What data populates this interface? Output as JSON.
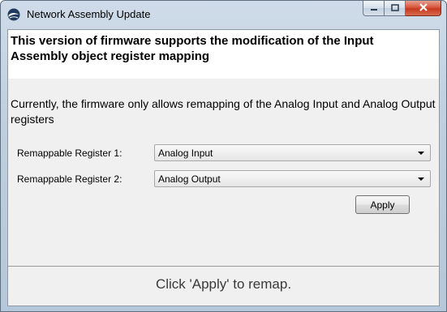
{
  "window": {
    "title": "Network Assembly Update",
    "app_icon": "network-globe-icon",
    "controls": [
      "minimize-icon",
      "maximize-icon",
      "close-icon"
    ],
    "close_color": "#c7391f"
  },
  "content": {
    "headline": "This version of firmware supports the modification of the Input Assembly object register mapping",
    "description": "Currently, the firmware only allows remapping of the Analog Input and Analog Output registers",
    "registers": [
      {
        "label": "Remappable Register 1:",
        "value": "Analog Input"
      },
      {
        "label": "Remappable Register 2:",
        "value": "Analog Output"
      }
    ],
    "apply_label": "Apply",
    "status": "Click 'Apply' to remap."
  }
}
